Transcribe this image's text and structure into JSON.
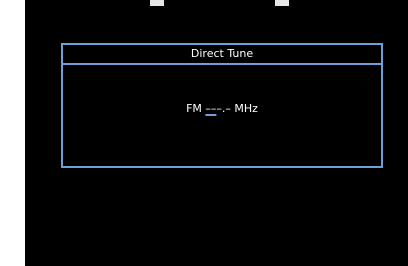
{
  "dialog": {
    "title": "Direct Tune",
    "band": "FM",
    "digits_entered": "––",
    "digits_remaining": "–.–",
    "unit": "MHz"
  },
  "colors": {
    "background": "#000000",
    "frame": "#6e9fd6",
    "text": "#ffffff"
  }
}
